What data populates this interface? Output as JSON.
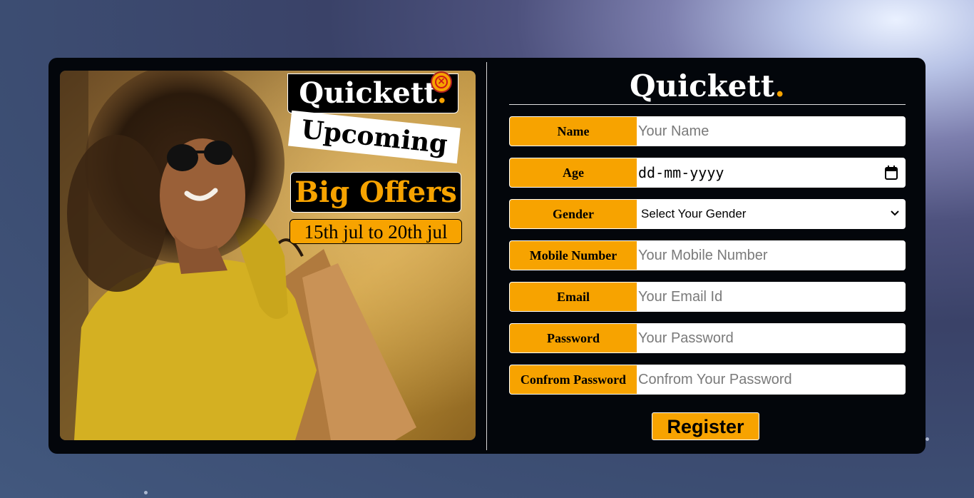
{
  "promo": {
    "brand_name": "Quickett",
    "brand_period": ".",
    "upcoming": "Upcoming",
    "offers": "Big Offers",
    "dates": "15th jul to 20th jul"
  },
  "form": {
    "brand_name": "Quickett",
    "brand_period": ".",
    "fields": [
      {
        "label": "Name",
        "placeholder": "Your Name"
      },
      {
        "label": "Age",
        "value": "dd-mm-yyyy"
      },
      {
        "label": "Gender",
        "value": "Select Your Gender"
      },
      {
        "label": "Mobile Number",
        "placeholder": "Your Mobile Number"
      },
      {
        "label": "Email",
        "placeholder": "Your Email Id"
      },
      {
        "label": "Password",
        "placeholder": "Your Password"
      },
      {
        "label": "Confrom Password",
        "placeholder": "Confrom Your Password"
      }
    ],
    "register_label": "Register"
  },
  "colors": {
    "accent": "#f7a300",
    "modal_bg": "#03060b",
    "close_red": "#d01818"
  },
  "icons": [
    "close-icon",
    "calendar-icon",
    "chevron-down-icon"
  ]
}
